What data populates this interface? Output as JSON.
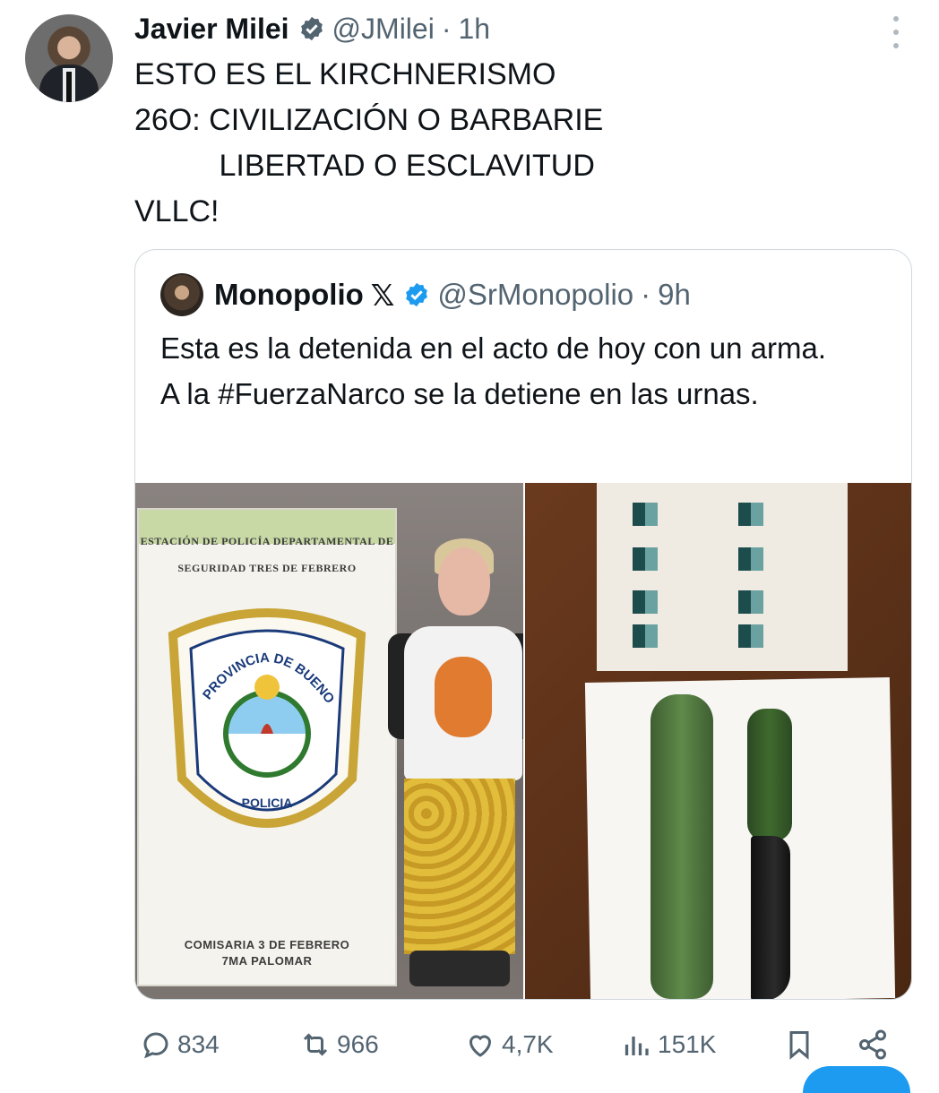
{
  "tweet": {
    "author_name": "Javier Milei",
    "handle": "@JMilei",
    "separator": "·",
    "time": "1h",
    "text": "ESTO ES EL KIRCHNERISMO\n26O: CIVILIZACIÓN O BARBARIE\n          LIBERTAD O ESCLAVITUD\nVLLC!"
  },
  "quote": {
    "author_name": "Monopolio",
    "x_badge": "𝕏",
    "handle": "@SrMonopolio",
    "separator": "·",
    "time": "9h",
    "text": "Esta es la detenida en el acto de hoy con un arma.\nA la #FuerzaNarco se la detiene en las urnas.",
    "banner": {
      "line1": "ESTACIÓN DE POLICÍA DEPARTAMENTAL DE",
      "line2": "SEGURIDAD TRES DE FEBRERO",
      "shield_arc": "PROVINCIA DE BUENOS AIRES",
      "shield_label": "POLICIA",
      "bottom1": "COMISARIA 3 DE FEBRERO",
      "bottom2": "7MA PALOMAR"
    }
  },
  "actions": {
    "replies": "834",
    "reposts": "966",
    "likes": "4,7K",
    "views": "151K"
  },
  "colors": {
    "verified": "#1d9bf0",
    "secondary_text": "#536471",
    "border": "#cfd9de"
  },
  "icons": [
    "verified-badge-icon",
    "more-options-icon",
    "reply-icon",
    "repost-icon",
    "like-icon",
    "views-icon",
    "bookmark-icon",
    "share-icon"
  ]
}
